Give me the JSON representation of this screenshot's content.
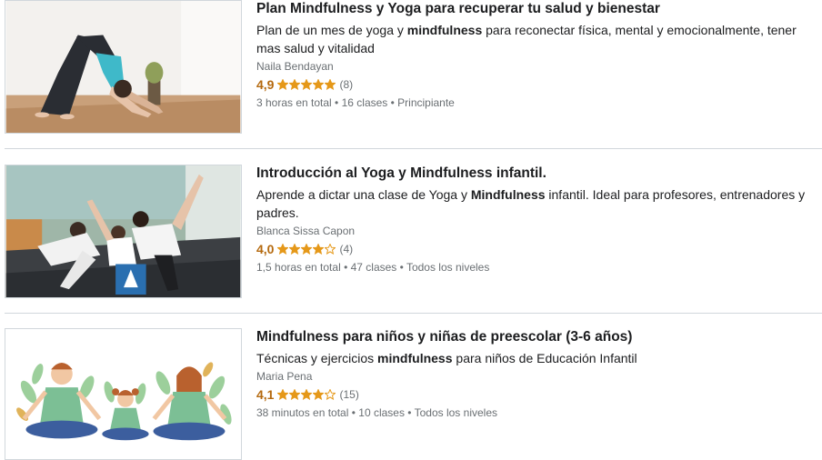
{
  "courses": [
    {
      "title": "Plan Mindfulness y Yoga para recuperar tu salud y bienestar",
      "headline_before": "Plan de un mes de yoga y ",
      "headline_bold": "mindfulness",
      "headline_after": " para reconectar física, mental y emocionalmente, tener mas salud y vitalidad",
      "instructor": "Naila Bendayan",
      "rating": "4,9",
      "rating_value": 4.9,
      "count": "(8)",
      "meta": "3 horas en total • 16 clases • Principiante"
    },
    {
      "title": "Introducción al Yoga y Mindfulness infantil.",
      "headline_before": "Aprende a dictar una clase de Yoga y ",
      "headline_bold": "Mindfulness",
      "headline_after": " infantil. Ideal para profesores, entrenadores y padres.",
      "instructor": "Blanca Sissa Capon",
      "rating": "4,0",
      "rating_value": 4.0,
      "count": "(4)",
      "meta": "1,5 horas en total • 47 clases • Todos los niveles"
    },
    {
      "title": "Mindfulness para niños y niñas de preescolar (3-6 años)",
      "headline_before": "Técnicas y ejercicios ",
      "headline_bold": "mindfulness",
      "headline_after": " para niños de Educación Infantil",
      "instructor": "Maria Pena",
      "rating": "4,1",
      "rating_value": 4.1,
      "count": "(15)",
      "meta": "38 minutos en total • 10 clases • Todos los niveles"
    }
  ],
  "colors": {
    "star": "#e59819",
    "rating_text": "#b4690e",
    "muted": "#6a6f73",
    "border": "#d1d7dc"
  }
}
